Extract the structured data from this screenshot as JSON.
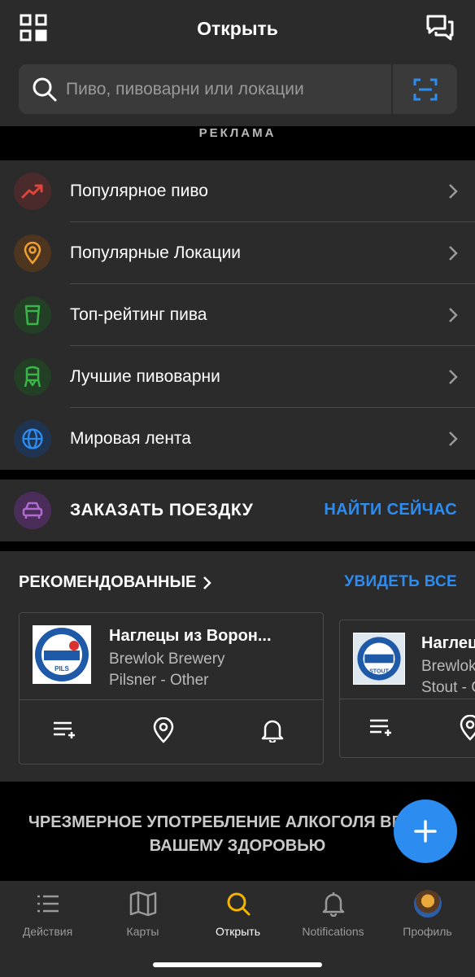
{
  "header": {
    "title": "Открыть"
  },
  "search": {
    "placeholder": "Пиво, пивоварни или локации"
  },
  "ad_label": "РЕКЛАМА",
  "menu": [
    {
      "label": "Популярное пиво",
      "icon": "trending-up-icon",
      "color": "#e0453c",
      "bg": "#4a2a2a"
    },
    {
      "label": "Популярные Локации",
      "icon": "location-pin-icon",
      "color": "#f0a030",
      "bg": "#4d3520"
    },
    {
      "label": "Топ-рейтинг пива",
      "icon": "beer-glass-icon",
      "color": "#3bb54a",
      "bg": "#233f26"
    },
    {
      "label": "Лучшие пивоварни",
      "icon": "brewery-tank-icon",
      "color": "#3bb54a",
      "bg": "#233f26"
    },
    {
      "label": "Мировая лента",
      "icon": "globe-icon",
      "color": "#2d8cf0",
      "bg": "#1f3450"
    }
  ],
  "ride": {
    "label": "ЗАКАЗАТЬ ПОЕЗДКУ",
    "action": "НАЙТИ СЕЙЧАС",
    "icon": "car-icon",
    "color": "#b36ad0"
  },
  "recommended": {
    "title": "РЕКОМЕНДОВАННЫЕ",
    "see_all": "УВИДЕТЬ ВСЕ",
    "cards": [
      {
        "name": "Наглецы из Ворон...",
        "brewery": "Brewlok Brewery",
        "style": "Pilsner - Other",
        "logo_text": "PILS"
      },
      {
        "name": "Наглец",
        "brewery": "Brewlok",
        "style": "Stout - C",
        "logo_text": "STOUT"
      }
    ]
  },
  "warning": {
    "line1": "ЧРЕЗМЕРНОЕ УПОТРЕБЛЕНИЕ АЛКОГОЛЯ ВРЕДИТ",
    "line2": "ВАШЕМУ ЗДОРОВЬЮ"
  },
  "tabs": [
    {
      "label": "Действия",
      "icon": "activity-list-icon",
      "active": false
    },
    {
      "label": "Карты",
      "icon": "map-icon",
      "active": false
    },
    {
      "label": "Открыть",
      "icon": "search-icon",
      "active": true
    },
    {
      "label": "Notifications",
      "icon": "bell-icon",
      "active": false
    },
    {
      "label": "Профиль",
      "icon": "avatar",
      "active": false
    }
  ],
  "colors": {
    "accent": "#2d8cf0",
    "active_tab": "#f5b400",
    "surface": "#2b2b2b"
  }
}
